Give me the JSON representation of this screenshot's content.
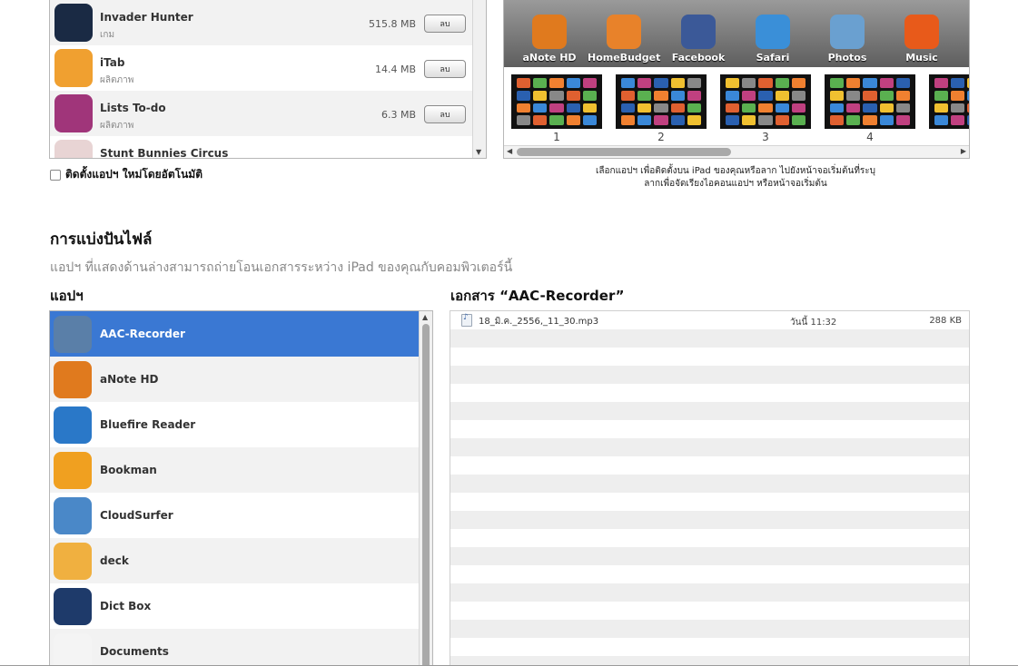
{
  "installed_apps": {
    "remove_label": "ลบ",
    "items": [
      {
        "name": "Invader Hunter",
        "category": "เกม",
        "size": "515.8 MB",
        "icon": "invader-hunter-icon",
        "color": "#1a2a44"
      },
      {
        "name": "iTab",
        "category": "ผลิตภาพ",
        "size": "14.4 MB",
        "icon": "itab-icon",
        "color": "#f0a030"
      },
      {
        "name": "Lists To-do",
        "category": "ผลิตภาพ",
        "size": "6.3 MB",
        "icon": "lists-todo-icon",
        "color": "#a0357a"
      },
      {
        "name": "Stunt Bunnies Circus",
        "category": "",
        "size": "",
        "icon": "stunt-bunnies-icon",
        "color": "#e8d4d4"
      }
    ],
    "auto_install_label": "ติดตั้งแอปฯ ใหม่โดยอัตโนมัติ"
  },
  "home_screen": {
    "dock_apps": [
      {
        "label": "aNote HD",
        "icon": "anote-icon",
        "color": "#e07a1e"
      },
      {
        "label": "HomeBudget",
        "icon": "homebudget-icon",
        "color": "#e8822a"
      },
      {
        "label": "Facebook",
        "icon": "facebook-icon",
        "color": "#3b5998"
      },
      {
        "label": "Safari",
        "icon": "safari-icon",
        "color": "#3a8fd8"
      },
      {
        "label": "Photos",
        "icon": "photos-icon",
        "color": "#6aa0d0"
      },
      {
        "label": "Music",
        "icon": "music-icon",
        "color": "#e85a1a"
      }
    ],
    "pages": [
      "1",
      "2",
      "3",
      "4"
    ],
    "hint_line1": "เลือกแอปฯ เพื่อติดตั้งบน iPad ของคุณหรือลาก ไปยังหน้าจอเริ่มต้นที่ระบุ",
    "hint_line2": "ลากเพื่อจัดเรียงไอคอนแอปฯ หรือหน้าจอเริ่มต้น"
  },
  "file_sharing": {
    "title": "การแบ่งปันไฟล์",
    "description": "แอปฯ ที่แสดงด้านล่างสามารถถ่ายโอนเอกสารระหว่าง iPad ของคุณกับคอมพิวเตอร์นี้",
    "apps_heading": "แอปฯ",
    "docs_heading": "เอกสาร “AAC-Recorder”",
    "apps": [
      {
        "name": "AAC-Recorder",
        "icon": "aac-recorder-icon",
        "color": "#5a7fa8",
        "selected": true
      },
      {
        "name": "aNote HD",
        "icon": "anote-icon",
        "color": "#e07a1e",
        "selected": false
      },
      {
        "name": "Bluefire Reader",
        "icon": "bluefire-icon",
        "color": "#2a78c8",
        "selected": false
      },
      {
        "name": "Bookman",
        "icon": "bookman-icon",
        "color": "#f0a020",
        "selected": false
      },
      {
        "name": "CloudSurfer",
        "icon": "cloudsurfer-icon",
        "color": "#4a88c8",
        "selected": false
      },
      {
        "name": "deck",
        "icon": "deck-icon",
        "color": "#f0b040",
        "selected": false
      },
      {
        "name": "Dict Box",
        "icon": "dictbox-icon",
        "color": "#1e3a6a",
        "selected": false
      },
      {
        "name": "Documents",
        "icon": "documents-icon",
        "color": "#f4f4f4",
        "selected": false
      }
    ],
    "documents": [
      {
        "name": "18_มิ.ค._2556,_11_30.mp3",
        "date": "วันนี้ 11:32",
        "size": "288 KB",
        "icon": "audio-file-icon"
      }
    ]
  }
}
